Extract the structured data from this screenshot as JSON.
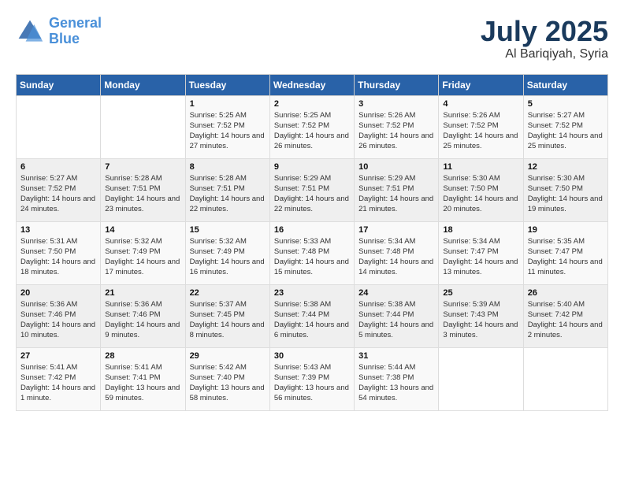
{
  "logo": {
    "line1": "General",
    "line2": "Blue"
  },
  "title": {
    "month": "July 2025",
    "location": "Al Bariqiyah, Syria"
  },
  "weekdays": [
    "Sunday",
    "Monday",
    "Tuesday",
    "Wednesday",
    "Thursday",
    "Friday",
    "Saturday"
  ],
  "weeks": [
    [
      {
        "day": "",
        "info": ""
      },
      {
        "day": "",
        "info": ""
      },
      {
        "day": "1",
        "sunrise": "5:25 AM",
        "sunset": "7:52 PM",
        "daylight": "14 hours and 27 minutes."
      },
      {
        "day": "2",
        "sunrise": "5:25 AM",
        "sunset": "7:52 PM",
        "daylight": "14 hours and 26 minutes."
      },
      {
        "day": "3",
        "sunrise": "5:26 AM",
        "sunset": "7:52 PM",
        "daylight": "14 hours and 26 minutes."
      },
      {
        "day": "4",
        "sunrise": "5:26 AM",
        "sunset": "7:52 PM",
        "daylight": "14 hours and 25 minutes."
      },
      {
        "day": "5",
        "sunrise": "5:27 AM",
        "sunset": "7:52 PM",
        "daylight": "14 hours and 25 minutes."
      }
    ],
    [
      {
        "day": "6",
        "sunrise": "5:27 AM",
        "sunset": "7:52 PM",
        "daylight": "14 hours and 24 minutes."
      },
      {
        "day": "7",
        "sunrise": "5:28 AM",
        "sunset": "7:51 PM",
        "daylight": "14 hours and 23 minutes."
      },
      {
        "day": "8",
        "sunrise": "5:28 AM",
        "sunset": "7:51 PM",
        "daylight": "14 hours and 22 minutes."
      },
      {
        "day": "9",
        "sunrise": "5:29 AM",
        "sunset": "7:51 PM",
        "daylight": "14 hours and 22 minutes."
      },
      {
        "day": "10",
        "sunrise": "5:29 AM",
        "sunset": "7:51 PM",
        "daylight": "14 hours and 21 minutes."
      },
      {
        "day": "11",
        "sunrise": "5:30 AM",
        "sunset": "7:50 PM",
        "daylight": "14 hours and 20 minutes."
      },
      {
        "day": "12",
        "sunrise": "5:30 AM",
        "sunset": "7:50 PM",
        "daylight": "14 hours and 19 minutes."
      }
    ],
    [
      {
        "day": "13",
        "sunrise": "5:31 AM",
        "sunset": "7:50 PM",
        "daylight": "14 hours and 18 minutes."
      },
      {
        "day": "14",
        "sunrise": "5:32 AM",
        "sunset": "7:49 PM",
        "daylight": "14 hours and 17 minutes."
      },
      {
        "day": "15",
        "sunrise": "5:32 AM",
        "sunset": "7:49 PM",
        "daylight": "14 hours and 16 minutes."
      },
      {
        "day": "16",
        "sunrise": "5:33 AM",
        "sunset": "7:48 PM",
        "daylight": "14 hours and 15 minutes."
      },
      {
        "day": "17",
        "sunrise": "5:34 AM",
        "sunset": "7:48 PM",
        "daylight": "14 hours and 14 minutes."
      },
      {
        "day": "18",
        "sunrise": "5:34 AM",
        "sunset": "7:47 PM",
        "daylight": "14 hours and 13 minutes."
      },
      {
        "day": "19",
        "sunrise": "5:35 AM",
        "sunset": "7:47 PM",
        "daylight": "14 hours and 11 minutes."
      }
    ],
    [
      {
        "day": "20",
        "sunrise": "5:36 AM",
        "sunset": "7:46 PM",
        "daylight": "14 hours and 10 minutes."
      },
      {
        "day": "21",
        "sunrise": "5:36 AM",
        "sunset": "7:46 PM",
        "daylight": "14 hours and 9 minutes."
      },
      {
        "day": "22",
        "sunrise": "5:37 AM",
        "sunset": "7:45 PM",
        "daylight": "14 hours and 8 minutes."
      },
      {
        "day": "23",
        "sunrise": "5:38 AM",
        "sunset": "7:44 PM",
        "daylight": "14 hours and 6 minutes."
      },
      {
        "day": "24",
        "sunrise": "5:38 AM",
        "sunset": "7:44 PM",
        "daylight": "14 hours and 5 minutes."
      },
      {
        "day": "25",
        "sunrise": "5:39 AM",
        "sunset": "7:43 PM",
        "daylight": "14 hours and 3 minutes."
      },
      {
        "day": "26",
        "sunrise": "5:40 AM",
        "sunset": "7:42 PM",
        "daylight": "14 hours and 2 minutes."
      }
    ],
    [
      {
        "day": "27",
        "sunrise": "5:41 AM",
        "sunset": "7:42 PM",
        "daylight": "14 hours and 1 minute."
      },
      {
        "day": "28",
        "sunrise": "5:41 AM",
        "sunset": "7:41 PM",
        "daylight": "13 hours and 59 minutes."
      },
      {
        "day": "29",
        "sunrise": "5:42 AM",
        "sunset": "7:40 PM",
        "daylight": "13 hours and 58 minutes."
      },
      {
        "day": "30",
        "sunrise": "5:43 AM",
        "sunset": "7:39 PM",
        "daylight": "13 hours and 56 minutes."
      },
      {
        "day": "31",
        "sunrise": "5:44 AM",
        "sunset": "7:38 PM",
        "daylight": "13 hours and 54 minutes."
      },
      {
        "day": "",
        "info": ""
      },
      {
        "day": "",
        "info": ""
      }
    ]
  ]
}
